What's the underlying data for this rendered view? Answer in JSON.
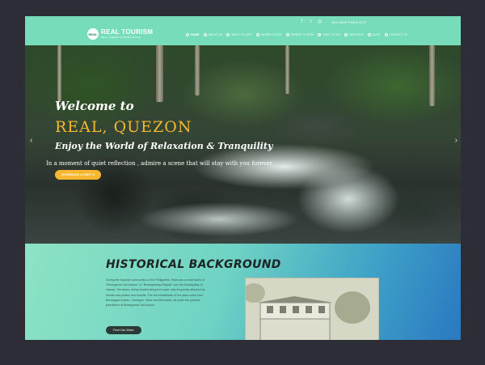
{
  "header": {
    "social_icons": [
      "facebook-icon",
      "twitter-icon",
      "instagram-icon"
    ],
    "registry_number": "09474059 PHNO NOT",
    "logo": {
      "badge": "REAL",
      "title": "REAL TOURISM",
      "tagline": "REAL, QUEZON TOURISM OFFICE"
    },
    "nav": [
      {
        "label": "HOME",
        "active": true
      },
      {
        "label": "ABOUT US"
      },
      {
        "label": "WHAT TO VISIT"
      },
      {
        "label": "WHERE TO EAT"
      },
      {
        "label": "WHERE TO STAY"
      },
      {
        "label": "WHAT TO DO"
      },
      {
        "label": "SERVICES"
      },
      {
        "label": "BLOG"
      },
      {
        "label": "CONTACT US"
      }
    ]
  },
  "hero": {
    "welcome": "Welcome to",
    "town": "REAL, QUEZON",
    "tagline": "Enjoy the World of Relaxation & Tranquility",
    "subline": "In a moment of quiet reflection , admire a scene that will stay with you forever",
    "cta_label": "SCHEDULE A VISIT ➜"
  },
  "history": {
    "title": "HISTORICAL BACKGROUND",
    "body": "During the Spanish colonization of the Philippines, Real was a small barrio of \"Binangonan Del Ampon\" or \"Binangonang Pakpak\" now the Municipality of Infanta. The barrio, being located along the coast, was frequently attacked by Muslim sea pirates and bandits. The first inhabitants of the place came from Barangays Kabulu, Camegon, Silian and Binonwan, all under the political jurisdiction of Binangonan Del Ampon.",
    "button_label": "Find Out More"
  },
  "colors": {
    "brand": "#77dcb9",
    "accent": "#f7b731",
    "dark": "#2b3a36"
  }
}
